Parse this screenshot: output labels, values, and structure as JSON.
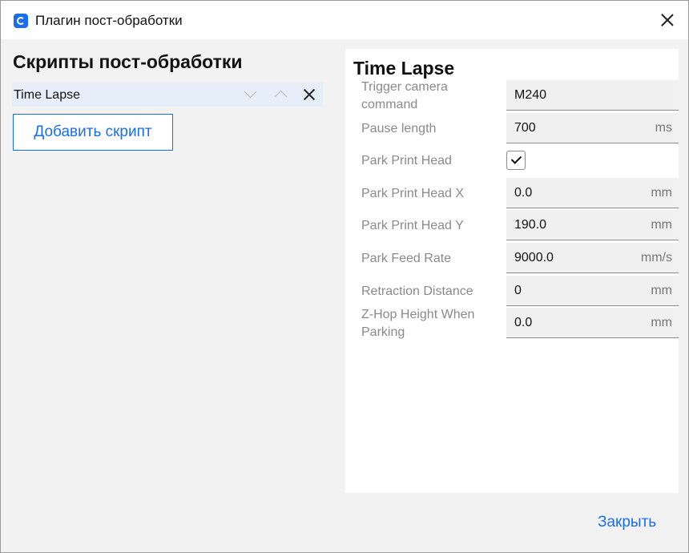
{
  "window": {
    "title": "Плагин пост-обработки",
    "app_icon": "cura-logo-icon",
    "accent": "#196ef0"
  },
  "left": {
    "heading": "Скрипты пост-обработки",
    "scripts": [
      {
        "name": "Time Lapse"
      }
    ],
    "add_button": "Добавить скрипт"
  },
  "settings": {
    "title": "Time Lapse",
    "rows": [
      {
        "label": "Trigger camera command",
        "value": "M240",
        "unit": ""
      },
      {
        "label": "Pause length",
        "value": "700",
        "unit": "ms"
      },
      {
        "label": "Park Print Head",
        "type": "checkbox",
        "checked": true
      },
      {
        "label": "Park Print Head X",
        "value": "0.0",
        "unit": "mm"
      },
      {
        "label": "Park Print Head Y",
        "value": "190.0",
        "unit": "mm"
      },
      {
        "label": "Park Feed Rate",
        "value": "9000.0",
        "unit": "mm/s"
      },
      {
        "label": "Retraction Distance",
        "value": "0",
        "unit": "mm"
      },
      {
        "label": "Z-Hop Height When Parking",
        "value": "0.0",
        "unit": "mm"
      }
    ]
  },
  "footer": {
    "close_label": "Закрыть"
  }
}
